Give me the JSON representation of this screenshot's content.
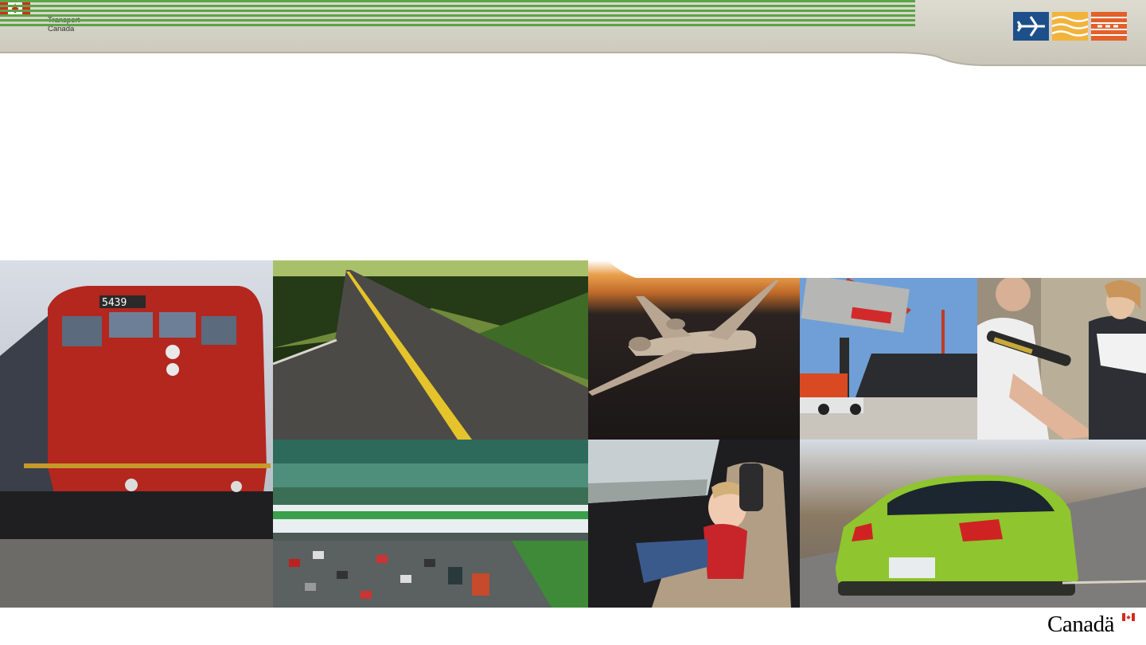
{
  "header": {
    "department_line1": "Transport",
    "department_line2": "Canada",
    "mode_icons": [
      "air-mode-icon",
      "marine-mode-icon",
      "rail-mode-icon"
    ]
  },
  "mosaic": {
    "photos": [
      {
        "subject": "locomotive-5439",
        "number_text": "5439"
      },
      {
        "subject": "highway-road"
      },
      {
        "subject": "business-jet"
      },
      {
        "subject": "container-crane"
      },
      {
        "subject": "airport-security-screening"
      },
      {
        "subject": "commuter-train-over-highway"
      },
      {
        "subject": "child-in-car-seat"
      },
      {
        "subject": "green-car"
      }
    ]
  },
  "footer": {
    "wordmark": "Canadä"
  },
  "colors": {
    "banner_gray": "#cdc9bd",
    "stripe_green": "#5aa546",
    "air_blue": "#1d4f8a",
    "marine_yellow": "#f2b33d",
    "rail_orange": "#e3602b",
    "flag_red": "#d52b1e"
  }
}
